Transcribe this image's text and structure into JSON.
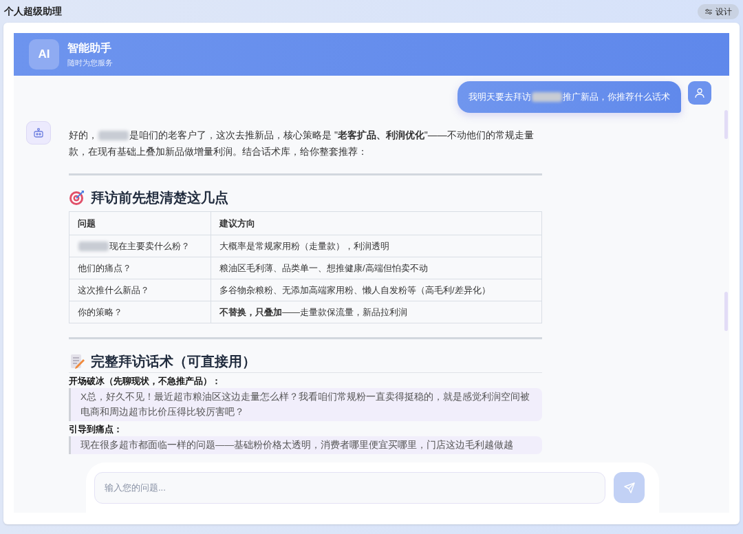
{
  "app_title": "个人超级助理",
  "design_button": "设计",
  "assistant": {
    "logo": "AI",
    "name": "智能助手",
    "subtitle": "随时为您服务"
  },
  "user_message": [
    {
      "kind": "text",
      "text": "我明天要去拜访"
    },
    {
      "kind": "redacted"
    },
    {
      "kind": "text",
      "text": "推广新品，你推荐什么话术"
    }
  ],
  "reply": {
    "intro": [
      {
        "kind": "text",
        "text": "好的，"
      },
      {
        "kind": "redacted"
      },
      {
        "kind": "text",
        "text": "是咱们的老客户了，这次去推新品，核心策略是 \"**老客扩品、利润优化**\"——不动他们的常规走量款，在现有基础上叠加新品做增量利润。结合话术库，给你整套推荐："
      }
    ],
    "sections": [
      {
        "kind": "table",
        "heading": "拜访前先想清楚这几点",
        "table": {
          "columns": [
            "问题",
            "建议方向"
          ],
          "rows": [
            [
              [
                {
                  "kind": "redacted"
                },
                {
                  "kind": "text",
                  "text": "现在主要卖什么粉？"
                }
              ],
              [
                {
                  "kind": "text",
                  "text": "大概率是常规家用粉（走量款），利润透明"
                }
              ]
            ],
            [
              [
                {
                  "kind": "text",
                  "text": "他们的痛点？"
                }
              ],
              [
                {
                  "kind": "text",
                  "text": "粮油区毛利薄、品类单一、想推健康/高端但怕卖不动"
                }
              ]
            ],
            [
              [
                {
                  "kind": "text",
                  "text": "这次推什么新品？"
                }
              ],
              [
                {
                  "kind": "text",
                  "text": "多谷物杂粮粉、无添加高端家用粉、懒人自发粉等（高毛利/差异化）"
                }
              ]
            ],
            [
              [
                {
                  "kind": "text",
                  "text": "你的策略？"
                }
              ],
              [
                {
                  "kind": "text",
                  "text": "**不替换，只叠加**——走量款保流量，新品拉利润"
                }
              ]
            ]
          ]
        }
      },
      {
        "kind": "scripts",
        "heading": "完整拜访话术（可直接用）",
        "scripts": [
          {
            "label": "开场破冰（先聊现状，不急推产品）：",
            "quote": "X总，好久不见！最近超市粮油区这边走量怎么样？我看咱们常规粉一直卖得挺稳的，就是感觉利润空间被电商和周边超市比价压得比较厉害吧？"
          },
          {
            "label": "引导到痛点：",
            "quote": "现在很多超市都面临一样的问题——基础粉价格太透明，消费者哪里便宜买哪里，门店这边毛利越做越"
          }
        ]
      }
    ]
  },
  "composer": {
    "placeholder": "输入您的问题..."
  }
}
